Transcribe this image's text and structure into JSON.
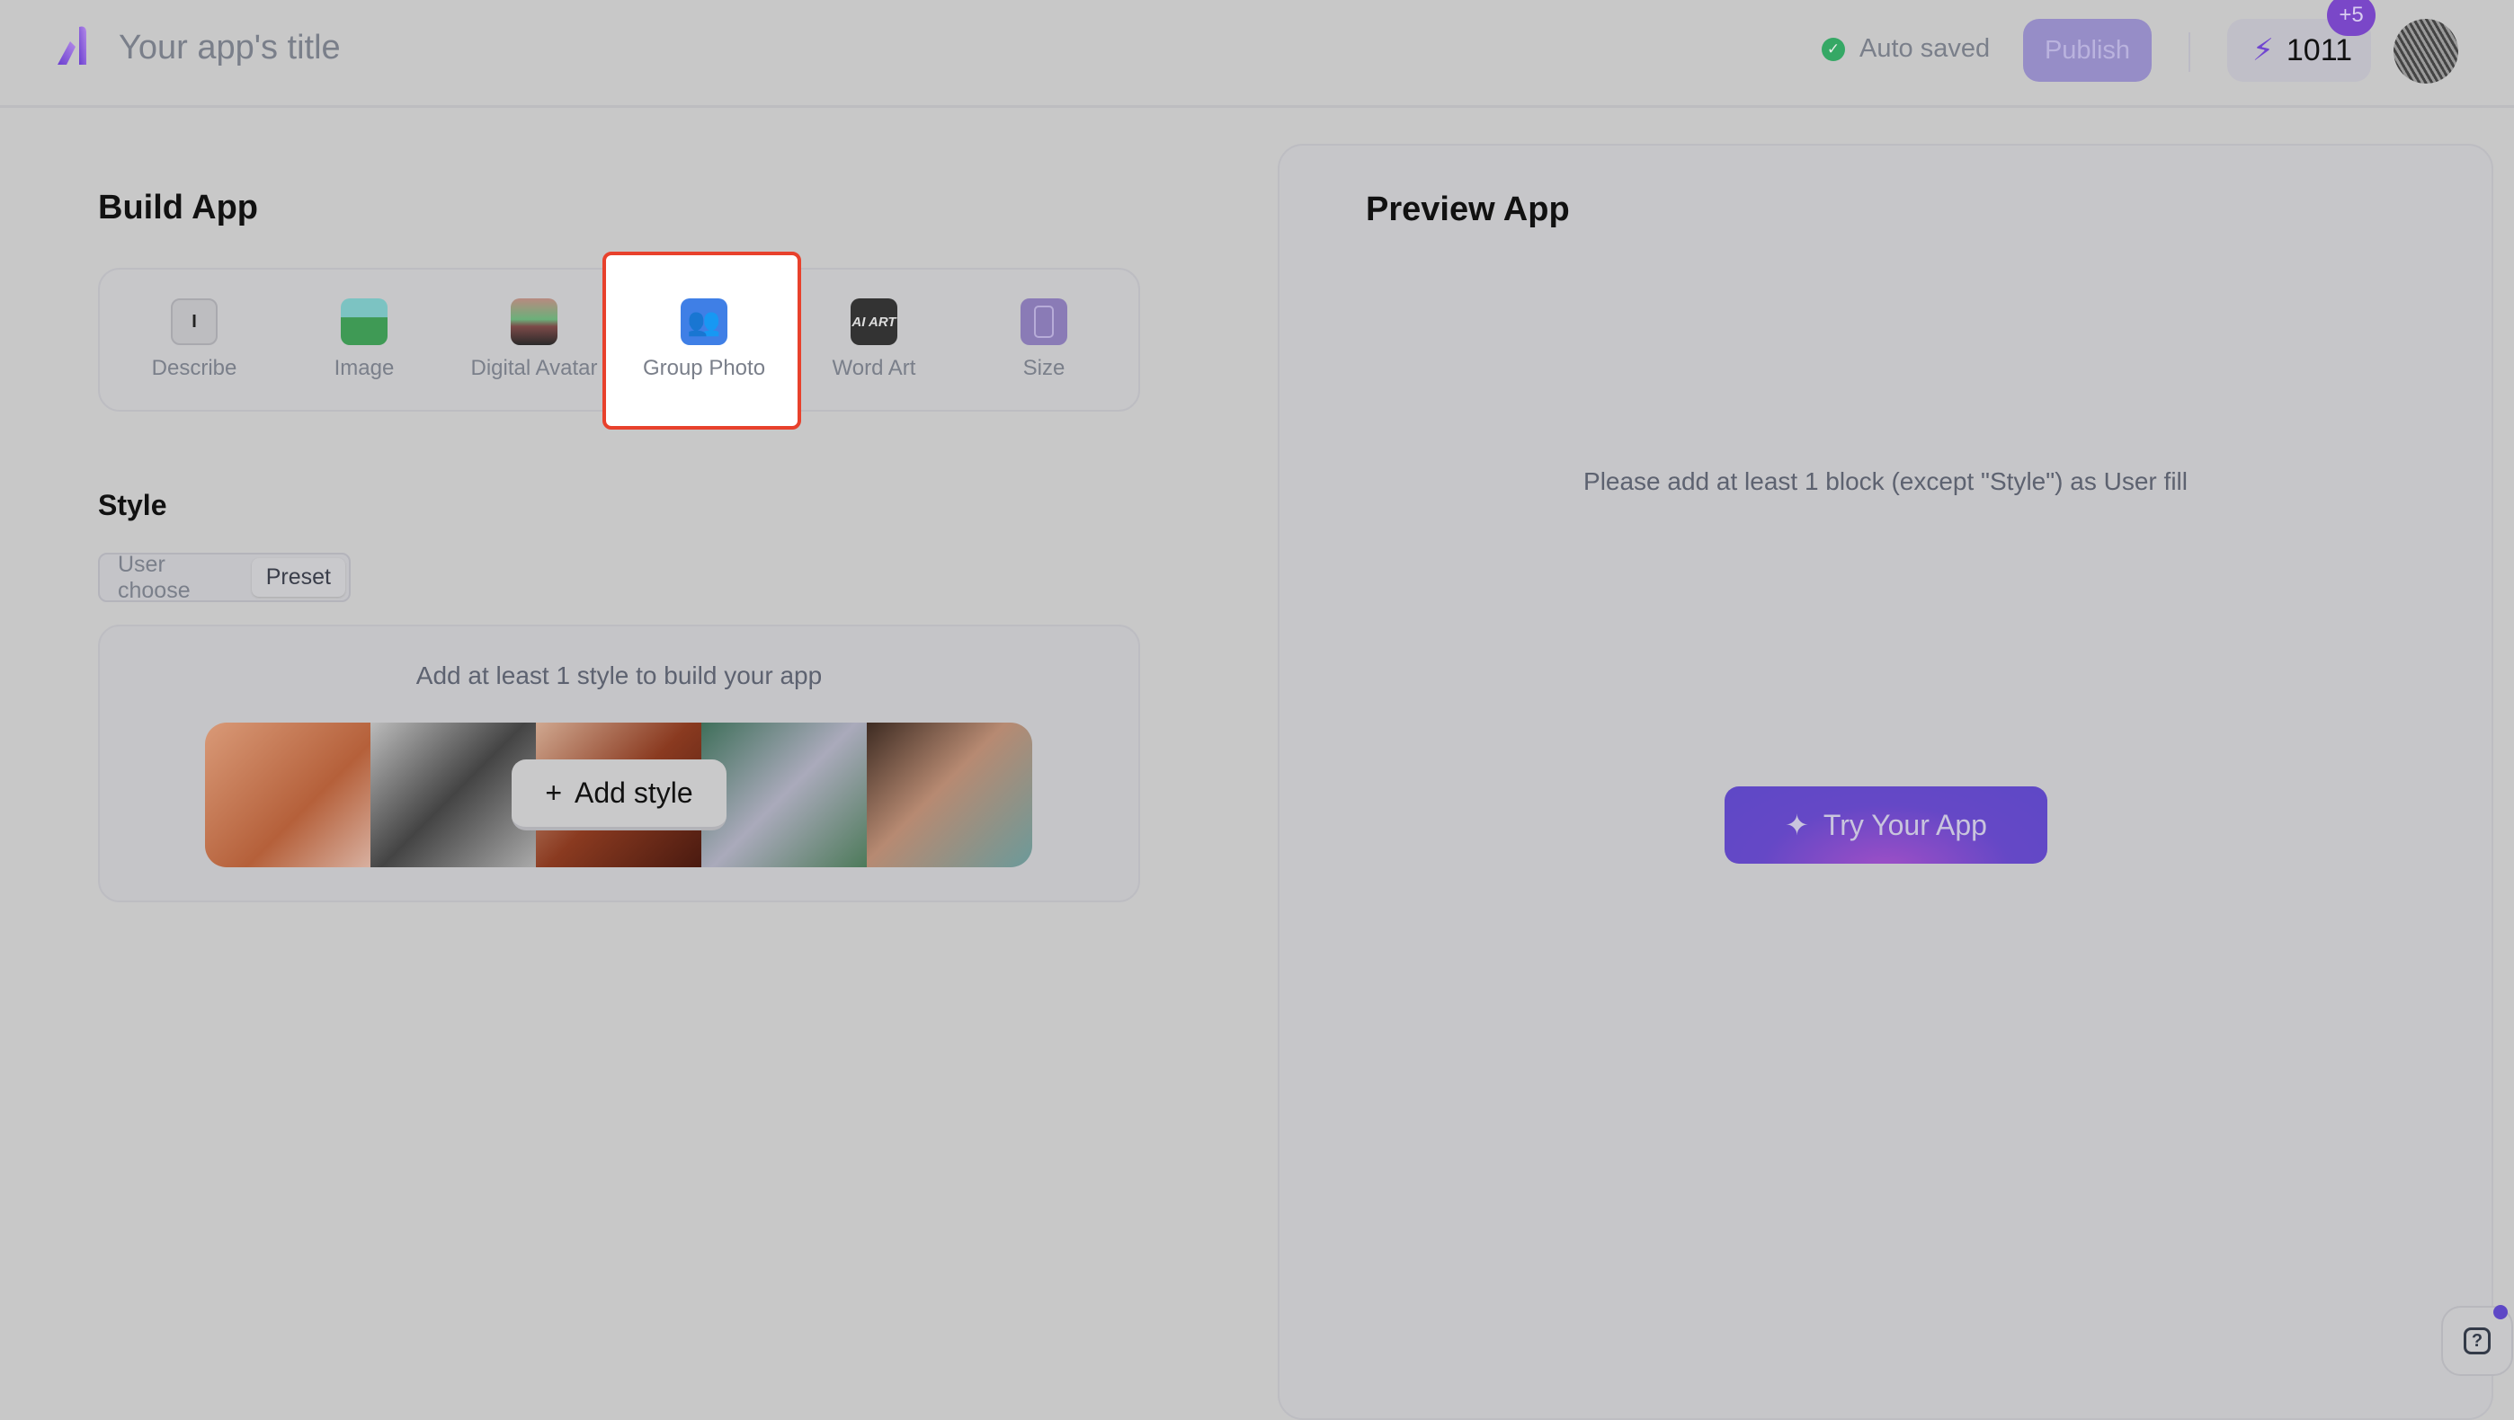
{
  "header": {
    "title": "Your app's title",
    "status": "Auto saved",
    "publish_label": "Publish",
    "credits": "1011",
    "credits_badge": "+5"
  },
  "build": {
    "title": "Build App",
    "tools": [
      {
        "label": "Describe",
        "icon": "text-cursor-icon"
      },
      {
        "label": "Image",
        "icon": "landscape-image-icon"
      },
      {
        "label": "Digital Avatar",
        "icon": "portrait-photo-icon"
      },
      {
        "label": "Group Photo",
        "icon": "people-icon"
      },
      {
        "label": "Word Art",
        "icon": "ai-art-icon",
        "icon_text": "AI ART"
      },
      {
        "label": "Size",
        "icon": "phone-size-icon"
      }
    ],
    "highlighted_tool": "Group Photo"
  },
  "style": {
    "title": "Style",
    "options": [
      "User choose",
      "Preset"
    ],
    "selected": "Preset",
    "message": "Add at least 1 style to build your app",
    "add_label": "Add style"
  },
  "preview": {
    "title": "Preview App",
    "message": "Please add at least 1 block (except \"Style\") as User fill",
    "try_label": "Try Your App"
  },
  "colors": {
    "accent": "#5e48c6",
    "highlight": "#e8412c",
    "success": "#35a865"
  }
}
